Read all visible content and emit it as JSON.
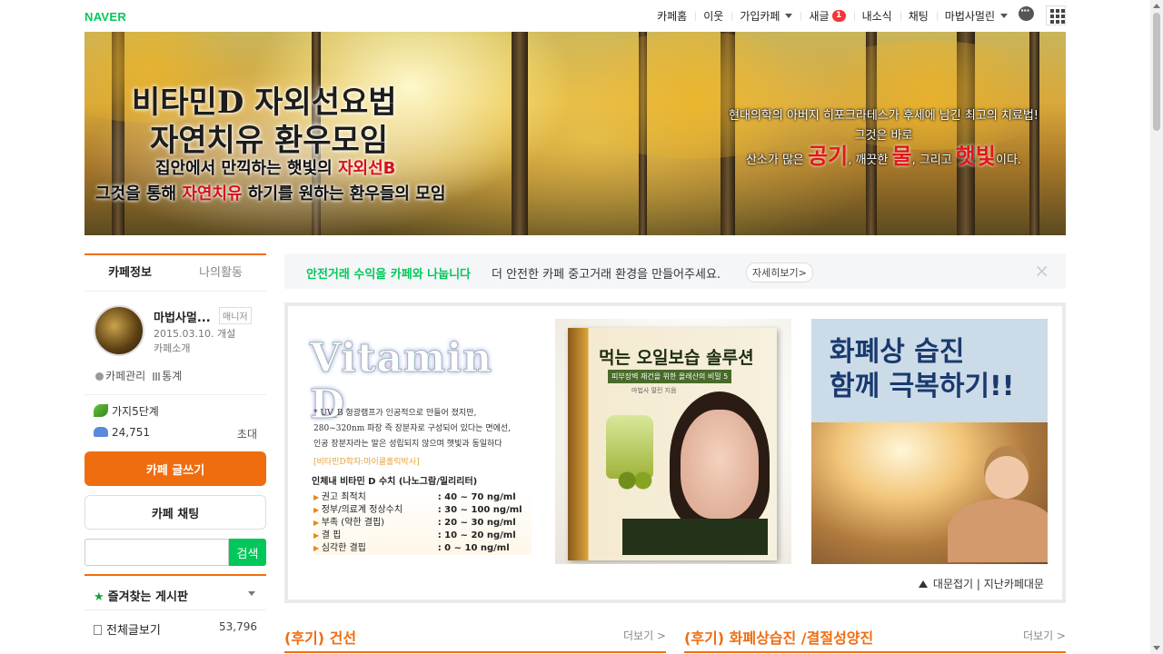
{
  "header": {
    "logo": "NAVER",
    "menu": [
      {
        "label": "카페홈",
        "caret": false
      },
      {
        "label": "이웃",
        "caret": false
      },
      {
        "label": "가입카페",
        "caret": true
      },
      {
        "label": "새글",
        "badge": "1"
      },
      {
        "label": "내소식",
        "caret": false
      },
      {
        "label": "채팅",
        "caret": false
      },
      {
        "label": "마법사멀린",
        "caret": true
      }
    ],
    "icons": [
      "chat-bubble-icon",
      "app-grid-icon"
    ]
  },
  "banner": {
    "title_line1": "비타민D 자외선요법",
    "title_line2": "자연치유 환우모임",
    "sub1_a": "집안에서 만끽하는 햇빛의 ",
    "sub1_b": "자외선B",
    "sub2_a": "그것을 통해 ",
    "sub2_b": "자연치유",
    "sub2_c": " 하기를 원하는 환우들의 모임",
    "right_line1": "현대의학의 아버지 히포크라테스가 후세에 남긴 최고의 치료법!",
    "right_line2": "그것은 바로",
    "right_line3_a": "산소가 많은 ",
    "right_big1": "공기",
    "right_line3_b": ", 깨끗한 ",
    "right_big2": "물",
    "right_line3_c": ", 그리고 ",
    "right_big3": "햇빛",
    "right_line3_d": "이다."
  },
  "sidebar": {
    "tab_info": "카페정보",
    "tab_activity": "나의활동",
    "cafe_name": "마법사멀...",
    "manager_badge": "매니저",
    "since": "2015.03.10. 개설",
    "intro": "카페소개",
    "manage": "카페관리",
    "stats": "통계",
    "level": "가지5단계",
    "members": "24,751",
    "invite": "초대",
    "write_button": "카페 글쓰기",
    "chat_button": "카페 채팅",
    "search_value": "",
    "search_button": "검색",
    "favorites_title": "즐겨찾는 게시판",
    "all_posts": "전체글보기",
    "all_posts_count": "53,796"
  },
  "notice": {
    "highlight": "안전거래 수익을 카페와 나눕니다",
    "text": "더 안전한 카페 중고거래 환경을 만들어주세요.",
    "more": "자세히보기>",
    "close": "×"
  },
  "board": {
    "panel1": {
      "logo": "Vitamin D",
      "line1": "* UV_B 형광램프가 인공적으로 만들어 졌지만,",
      "line2": "280~320nm 파장 즉 장분자로 구성되어 있다는 면에선,",
      "line3": "인공 장분자라는 말은 성립되지 않으며 햇빛과 동일하다",
      "tag": "[비타민D학자:마이클홀릭박사]",
      "heading": "인체내 비타민 D 수치 (나노그람/밀리리터)",
      "rows": [
        {
          "label": "권고 최적치",
          "value": ": 40 ~ 70 ng/ml"
        },
        {
          "label": "정부/의료계 정상수치",
          "value": ": 30 ~ 100 ng/ml"
        },
        {
          "label": "부족 (약한 결핍)",
          "value": ": 20 ~ 30 ng/ml"
        },
        {
          "label": "결 핍",
          "value": ": 10 ~ 20 ng/ml"
        },
        {
          "label": "심각한 결핍",
          "value": ": 0 ~ 10 ng/ml"
        }
      ]
    },
    "panel2": {
      "title": "먹는 오일보습 솔루션",
      "subtitle": "피부장벽 재건을 위한 올레산의 비밀 5",
      "author": "마법사 멀린 지음"
    },
    "panel3": {
      "line1": "화폐상 습진",
      "line2": "함께 극복하기!!"
    },
    "fold_label": "대문접기 | 지난카페대문"
  },
  "sections": [
    {
      "title": "(후기) 건선",
      "more": "더보기 >"
    },
    {
      "title": "(후기) 화폐상습진 /결절성양진",
      "more": "더보기 >"
    }
  ],
  "colors": {
    "accent": "#f06d0f",
    "naver_green": "#03c75a",
    "badge_red": "#f53535"
  }
}
